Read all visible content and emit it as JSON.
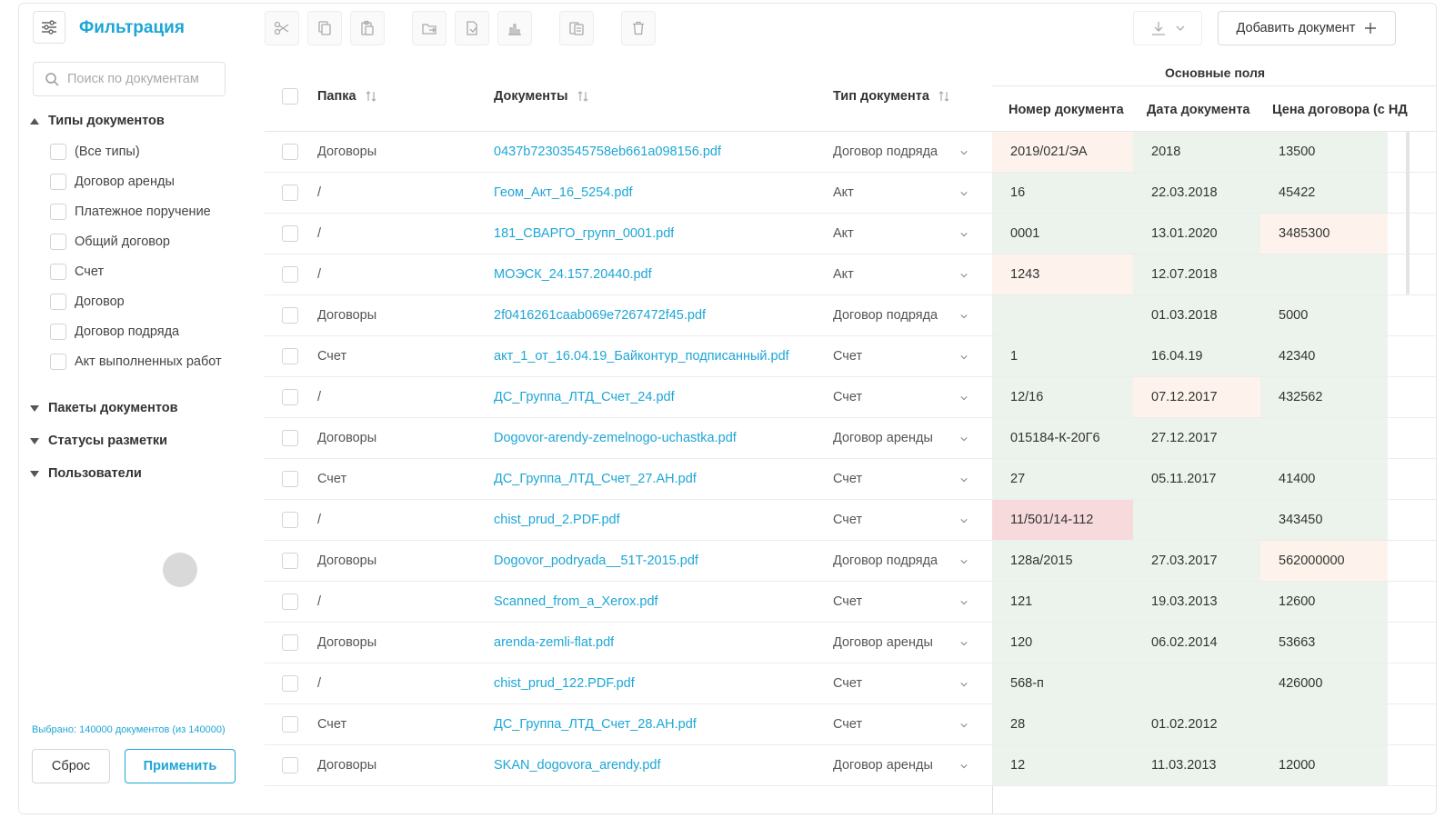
{
  "sidebar": {
    "title": "Фильтрация",
    "search_placeholder": "Поиск по документам",
    "groups": {
      "doc_types": {
        "label": "Типы документов",
        "items": [
          "(Все типы)",
          "Договор аренды",
          "Платежное поручение",
          "Общий договор",
          "Счет",
          "Договор",
          "Договор подряда",
          "Акт выполненных работ"
        ]
      },
      "packages": "Пакеты документов",
      "statuses": "Статусы разметки",
      "users": "Пользователи"
    },
    "selected_info": "Выбрано: 140000 документов (из 140000)",
    "reset_label": "Сброс",
    "apply_label": "Применить"
  },
  "toolbar": {
    "icons": [
      "scissors-icon",
      "copy-icon",
      "paste-icon",
      "move-folder-icon",
      "export-icon",
      "chart-icon",
      "duplicate-icon",
      "trash-icon"
    ],
    "download_icon": "download-icon",
    "add_label": "Добавить документ"
  },
  "table": {
    "headers": {
      "folder": "Папка",
      "documents": "Документы",
      "doc_type": "Тип документа",
      "main_fields": "Основные поля",
      "doc_number": "Номер документа",
      "doc_date": "Дата документа",
      "contract_price": "Цена договора (с НД"
    },
    "rows": [
      {
        "folder": "Договоры",
        "doc": "0437b72303545758eb661a098156.pdf",
        "type": "Договор подряда",
        "num": "2019/021/ЭА",
        "date": "2018",
        "price": "13500"
      },
      {
        "folder": "/",
        "doc": "Геом_Акт_16_5254.pdf",
        "type": "Акт",
        "num": "16",
        "date": "22.03.2018",
        "price": "45422"
      },
      {
        "folder": "/",
        "doc": "181_СВАРГО_групп_0001.pdf",
        "type": "Акт",
        "num": "0001",
        "date": "13.01.2020",
        "price": "3485300"
      },
      {
        "folder": "/",
        "doc": "МОЭСК_24.157.20440.pdf",
        "type": "Акт",
        "num": "1243",
        "date": "12.07.2018",
        "price": ""
      },
      {
        "folder": "Договоры",
        "doc": "2f0416261caab069e7267472f45.pdf",
        "type": "Договор подряда",
        "num": "",
        "date": "01.03.2018",
        "price": "5000"
      },
      {
        "folder": "Счет",
        "doc": "акт_1_от_16.04.19_Байконтур_подписанный.pdf",
        "type": "Счет",
        "num": "1",
        "date": "16.04.19",
        "price": "42340"
      },
      {
        "folder": "/",
        "doc": "ДС_Группа_ЛТД_Счет_24.pdf",
        "type": "Счет",
        "num": "12/16",
        "date": "07.12.2017",
        "price": "432562"
      },
      {
        "folder": "Договоры",
        "doc": "Dogovor-arendy-zemelnogo-uchastka.pdf",
        "type": "Договор аренды",
        "num": "015184-К-20Г6",
        "date": "27.12.2017",
        "price": ""
      },
      {
        "folder": "Счет",
        "doc": "ДС_Группа_ЛТД_Счет_27.АН.pdf",
        "type": "Счет",
        "num": "27",
        "date": "05.11.2017",
        "price": "41400"
      },
      {
        "folder": "/",
        "doc": "chist_prud_2.PDF.pdf",
        "type": "Счет",
        "num": "11/501/14-112",
        "date": "",
        "price": "343450"
      },
      {
        "folder": "Договоры",
        "doc": "Dogovor_podryada__51T-2015.pdf",
        "type": "Договор подряда",
        "num": "128a/2015",
        "date": "27.03.2017",
        "price": "562000000"
      },
      {
        "folder": "/",
        "doc": "Scanned_from_a_Xerox.pdf",
        "type": "Счет",
        "num": "121",
        "date": "19.03.2013",
        "price": "12600"
      },
      {
        "folder": "Договоры",
        "doc": "arenda-zemli-flat.pdf",
        "type": "Договор аренды",
        "num": "120",
        "date": "06.02.2014",
        "price": "53663"
      },
      {
        "folder": "/",
        "doc": "chist_prud_122.PDF.pdf",
        "type": "Счет",
        "num": "568-п",
        "date": "",
        "price": "426000"
      },
      {
        "folder": "Счет",
        "doc": "ДС_Группа_ЛТД_Счет_28.АН.pdf",
        "type": "Счет",
        "num": "28",
        "date": "01.02.2012",
        "price": ""
      },
      {
        "folder": "Договоры",
        "doc": "SKAN_dogovora_arendy.pdf",
        "type": "Договор аренды",
        "num": "12",
        "date": "11.03.2013",
        "price": "12000"
      }
    ],
    "cell_status": [
      [
        "warn",
        "ok",
        "ok"
      ],
      [
        "ok",
        "ok",
        "ok"
      ],
      [
        "ok",
        "ok",
        "warn"
      ],
      [
        "warn",
        "ok",
        "ok"
      ],
      [
        "ok",
        "ok",
        "ok"
      ],
      [
        "ok",
        "ok",
        "ok"
      ],
      [
        "ok",
        "warn",
        "ok"
      ],
      [
        "ok",
        "ok",
        "ok"
      ],
      [
        "ok",
        "ok",
        "ok"
      ],
      [
        "bad",
        "ok",
        "ok"
      ],
      [
        "ok",
        "ok",
        "warn"
      ],
      [
        "ok",
        "ok",
        "ok"
      ],
      [
        "ok",
        "ok",
        "ok"
      ],
      [
        "ok",
        "ok",
        "ok"
      ],
      [
        "ok",
        "ok",
        "ok"
      ],
      [
        "ok",
        "ok",
        "ok"
      ]
    ]
  },
  "colors": {
    "accent": "#1da6d6",
    "ok": "#ebf3ec",
    "warn": "#fdf3ec",
    "bad": "#f7dbdc"
  }
}
